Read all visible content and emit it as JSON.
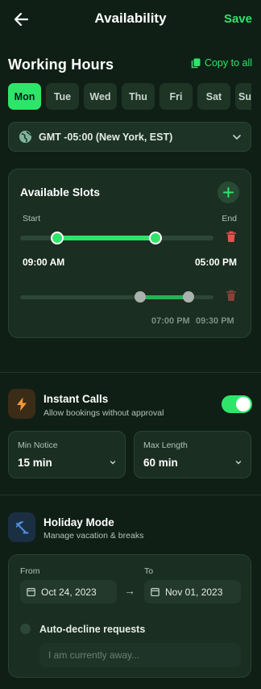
{
  "header": {
    "title": "Availability",
    "save_label": "Save"
  },
  "working_hours": {
    "title": "Working Hours",
    "copy_label": "Copy to all",
    "days": [
      "Mon",
      "Tue",
      "Wed",
      "Thu",
      "Fri",
      "Sat",
      "Su"
    ],
    "selected_day": "Mon",
    "timezone": "GMT -05:00 (New York, EST)"
  },
  "slots": {
    "title": "Available Slots",
    "start_label": "Start",
    "end_label": "End",
    "items": [
      {
        "start": "09:00 AM",
        "end": "05:00 PM",
        "active": true,
        "range_start_fraction": 0.19,
        "range_end_fraction": 0.7
      },
      {
        "start": "07:00 PM",
        "end": "09:30 PM",
        "active": false,
        "range_start_fraction": 0.62,
        "range_end_fraction": 0.87
      }
    ]
  },
  "instant_calls": {
    "title": "Instant Calls",
    "subtitle": "Allow bookings without approval",
    "enabled": true,
    "min_notice": {
      "label": "Min Notice",
      "value": "15 min"
    },
    "max_length": {
      "label": "Max Length",
      "value": "60 min"
    }
  },
  "holiday": {
    "title": "Holiday Mode",
    "subtitle": "Manage vacation & breaks",
    "from_label": "From",
    "from_value": "Oct 24, 2023",
    "to_label": "To",
    "to_value": "Nov 01, 2023",
    "arrow": "→",
    "auto_decline_label": "Auto-decline requests",
    "message_placeholder": "I am currently away..."
  },
  "colors": {
    "accent": "#2ee56a",
    "danger": "#e0544c",
    "background": "#0f1f16"
  }
}
